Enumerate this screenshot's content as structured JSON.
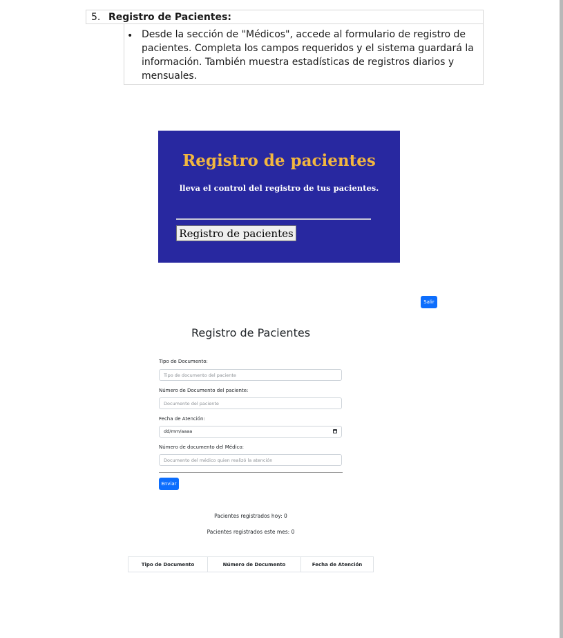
{
  "document": {
    "item_number": "5.",
    "item_title": "Registro de Pacientes:",
    "bullet": "Desde la sección de \"Médicos\", accede al formulario de registro de pacientes. Completa los campos requeridos y el sistema guardará la información. También muestra estadísticas de registros diarios y mensuales."
  },
  "banner": {
    "title": "Registro de pacientes",
    "subtitle": "lleva el control del registro de tus pacientes.",
    "button_label": "Registro de pacientes",
    "background_color": "#2828a0",
    "title_color": "#f2b640"
  },
  "app": {
    "logout_label": "Salir",
    "page_title": "Registro de Pacientes",
    "form": {
      "doc_type_label": "Tipo de Documento:",
      "doc_type_placeholder": "Tipo de documento del paciente",
      "doc_number_label": "Número de Documento del paciente:",
      "doc_number_placeholder": "Documento del paciente",
      "date_label": "Fecha de Atención:",
      "date_value": "dd/mm/aaaa",
      "doctor_label": "Número de documento del Médico:",
      "doctor_placeholder": "Documento del médico quien realizó la atención",
      "submit_label": "Enviar"
    },
    "stats": {
      "today": "Pacientes registrados hoy: 0",
      "month": "Pacientes registrados este mes: 0"
    },
    "table": {
      "headers": [
        "Tipo de Documento",
        "Número de Documento",
        "Fecha de Atención"
      ]
    },
    "accent_color": "#0d6efd"
  }
}
